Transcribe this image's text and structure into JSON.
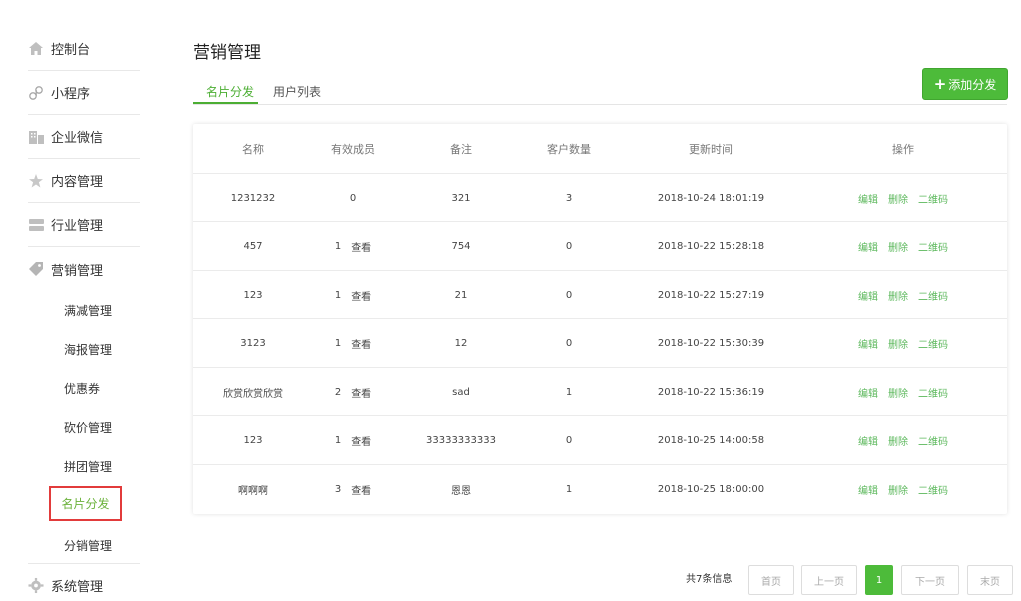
{
  "sidebar": {
    "items": [
      {
        "label": "控制台",
        "icon": "home-icon"
      },
      {
        "label": "小程序",
        "icon": "mini-program-icon"
      },
      {
        "label": "企业微信",
        "icon": "enterprise-wechat-icon"
      },
      {
        "label": "内容管理",
        "icon": "content-icon"
      },
      {
        "label": "行业管理",
        "icon": "industry-icon"
      },
      {
        "label": "营销管理",
        "icon": "tag-icon"
      }
    ],
    "sub_items": [
      "满减管理",
      "海报管理",
      "优惠券",
      "砍价管理",
      "拼团管理",
      "名片分发",
      "分销管理"
    ],
    "bottom_item": {
      "label": "系统管理",
      "icon": "gear-icon"
    }
  },
  "main": {
    "title": "营销管理",
    "tabs": [
      {
        "label": "名片分发",
        "active": true
      },
      {
        "label": "用户列表",
        "active": false
      }
    ],
    "add_button": {
      "plus": "+",
      "label": "添加分发"
    }
  },
  "table": {
    "headers": [
      "名称",
      "有效成员",
      "备注",
      "客户数量",
      "更新时间",
      "操作"
    ],
    "view_label": "查看",
    "actions": [
      "编辑",
      "删除",
      "二维码"
    ],
    "rows": [
      {
        "name": "1231232",
        "members": "0",
        "has_view": false,
        "remark": "321",
        "customers": "3",
        "updated": "2018-10-24 18:01:19"
      },
      {
        "name": "457",
        "members": "1",
        "has_view": true,
        "remark": "754",
        "customers": "0",
        "updated": "2018-10-22 15:28:18"
      },
      {
        "name": "123",
        "members": "1",
        "has_view": true,
        "remark": "21",
        "customers": "0",
        "updated": "2018-10-22 15:27:19"
      },
      {
        "name": "3123",
        "members": "1",
        "has_view": true,
        "remark": "12",
        "customers": "0",
        "updated": "2018-10-22 15:30:39"
      },
      {
        "name": "欣赏欣赏欣赏",
        "members": "2",
        "has_view": true,
        "remark": "sad",
        "customers": "1",
        "updated": "2018-10-22 15:36:19"
      },
      {
        "name": "123",
        "members": "1",
        "has_view": true,
        "remark": "33333333333",
        "customers": "0",
        "updated": "2018-10-25 14:00:58"
      },
      {
        "name": "啊啊啊",
        "members": "3",
        "has_view": true,
        "remark": "恩恩",
        "customers": "1",
        "updated": "2018-10-25 18:00:00"
      }
    ]
  },
  "pagination": {
    "info": "共7条信息",
    "first": "首页",
    "prev": "上一页",
    "current": "1",
    "next": "下一页",
    "last": "末页"
  },
  "colors": {
    "accent": "#4dbb3a",
    "link": "#5cb85c",
    "highlight_border": "#e23b3b"
  }
}
